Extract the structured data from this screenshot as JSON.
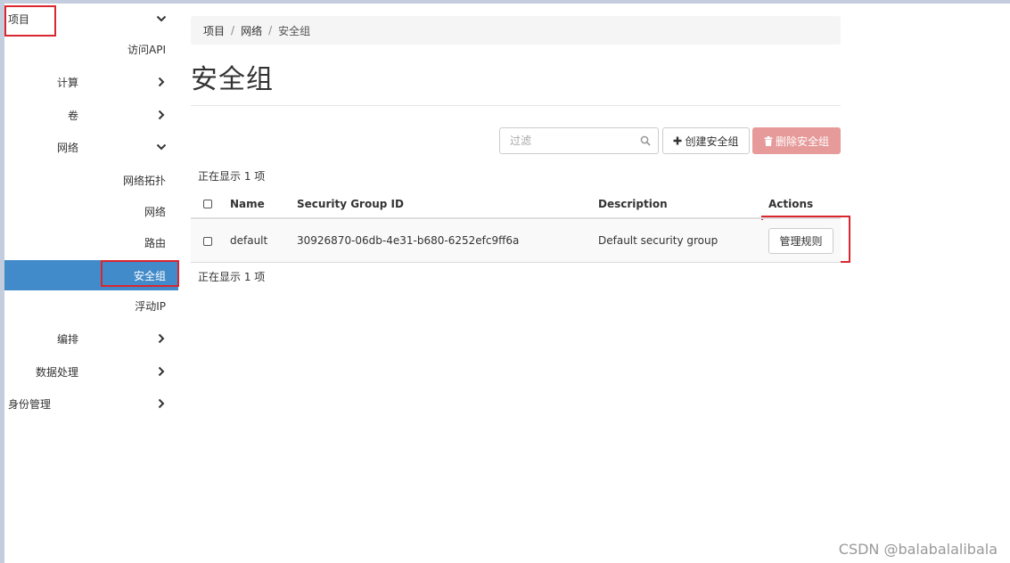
{
  "sidebar": {
    "project": "项目",
    "api_access": "访问API",
    "compute": "计算",
    "volumes": "卷",
    "network": "网络",
    "network_topology": "网络拓扑",
    "networks": "网络",
    "routers": "路由",
    "security_groups": "安全组",
    "floating_ips": "浮动IP",
    "orchestration": "编排",
    "data_processing": "数据处理",
    "identity": "身份管理"
  },
  "breadcrumb": [
    "项目",
    "网络",
    "安全组"
  ],
  "page_title": "安全组",
  "toolbar": {
    "filter_placeholder": "过滤",
    "create_label": "创建安全组",
    "delete_label": "删除安全组"
  },
  "count_text": "正在显示 1 项",
  "table": {
    "columns": [
      "Name",
      "Security Group ID",
      "Description",
      "Actions"
    ],
    "rows": [
      {
        "name": "default",
        "id": "30926870-06db-4e31-b680-6252efc9ff6a",
        "description": "Default security group",
        "action": "管理规则"
      }
    ]
  },
  "watermark": "CSDN @balabalalibala",
  "colors": {
    "active_nav": "#428bca",
    "highlight": "#d9262f",
    "danger_button": "#e69a9a"
  }
}
